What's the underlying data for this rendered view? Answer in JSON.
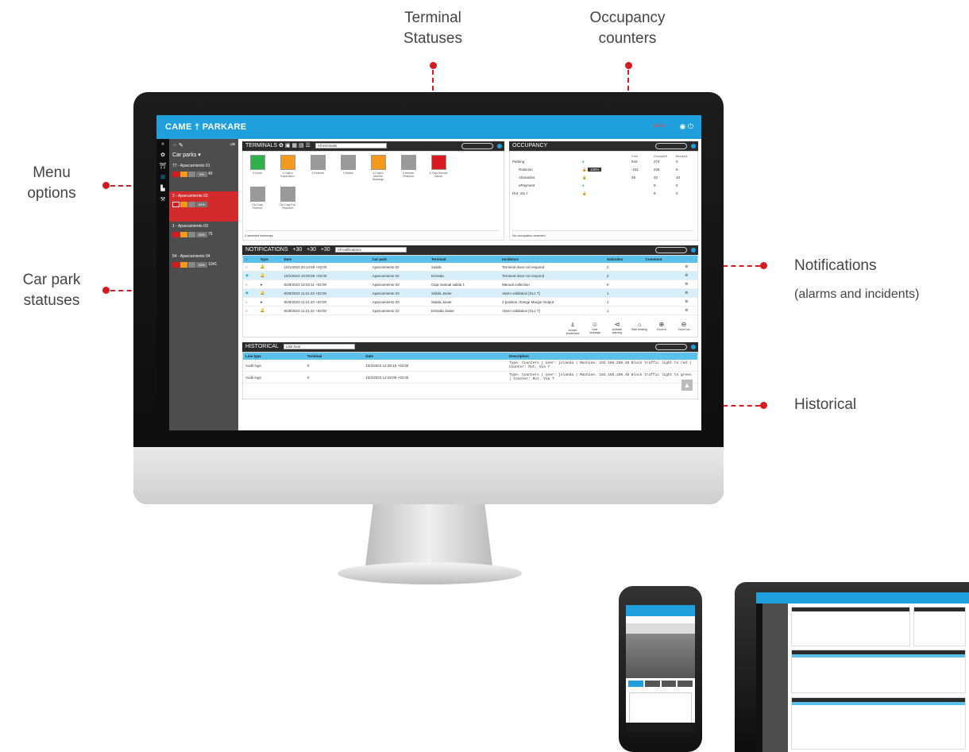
{
  "callouts": {
    "terminal_statuses": "Terminal\nStatuses",
    "occupancy_counters": "Occupancy\ncounters",
    "menu_options": "Menu\noptions",
    "car_park_statuses": "Car park\nstatuses",
    "notifications": "Notifications",
    "notifications_sub": "(alarms and incidents)",
    "historical": "Historical"
  },
  "app": {
    "brand": "CAME † PARKARE",
    "user": "admin"
  },
  "car_parks": {
    "header": "Car parks ▾",
    "items": [
      {
        "name": "77 - Aparcamiento 01",
        "pct": "9%",
        "n": "45"
      },
      {
        "name": "2 - Aparcamiento 02",
        "pct": "64%",
        "n": ""
      },
      {
        "name": "1 - Aparcamiento 03",
        "pct": "50%",
        "n": "75"
      },
      {
        "name": "54 - Aparcamiento 04",
        "pct": "50%",
        "n": "1041"
      }
    ]
  },
  "terminals": {
    "title": "TERMINALS",
    "filter": "All terminals",
    "footer": "2 selected terminals",
    "items": [
      {
        "label": "3-Inode",
        "color": "#2fb04a"
      },
      {
        "label": "1-Cajero Automatico",
        "color": "#f39a1e"
      },
      {
        "label": "2-Entrada",
        "color": "#8c8c8c"
      },
      {
        "label": "3-Salida",
        "color": "#8c8c8c"
      },
      {
        "label": "4-Cajero Manual Message",
        "color": "#f39a1e"
      },
      {
        "label": "5-Modulo Peatonal",
        "color": "#8c8c8c"
      },
      {
        "label": "6-Caja Manual Salida",
        "color": "#d71920"
      },
      {
        "label": "Ctrl-Caja Externa",
        "color": "#8c8c8c"
      },
      {
        "label": "Ctrl-Caja Ent. Payment",
        "color": "#8c8c8c"
      }
    ]
  },
  "occupancy": {
    "title": "OCCUPANCY",
    "footer": "No occupation selected",
    "columns": [
      "Free",
      "Occupied",
      "Blocked"
    ],
    "rows": [
      {
        "name": "Parking",
        "pct": "",
        "free": "543",
        "occ": "274",
        "blk": "0"
      },
      {
        "name": "Rotacion",
        "pct": "100%",
        "free": "-151",
        "occ": "226",
        "blk": "5"
      },
      {
        "name": "Abonados",
        "pct": "",
        "free": "48",
        "occ": "42",
        "blk": "10"
      },
      {
        "name": "ePayment",
        "pct": "",
        "free": "",
        "occ": "8",
        "blk": "0"
      },
      {
        "name": "Rot. Via 7",
        "pct": "",
        "free": "",
        "occ": "8",
        "blk": "0"
      }
    ]
  },
  "notifications": {
    "title": "NOTIFICATIONS",
    "counts": [
      "+30",
      "+30",
      "+30"
    ],
    "filter": "All notifications",
    "columns": [
      "Type",
      "Date",
      "Car park",
      "Terminal",
      "Incidence",
      "Subindex",
      "Comment"
    ],
    "rows": [
      {
        "date": "10/1/2023 20:14:59 +02:00",
        "park": "Aparcamiento 02",
        "term": "Salida",
        "inc": "Terminal does not respond",
        "sub": "2"
      },
      {
        "date": "10/1/2023 19:00:59 +02:00",
        "park": "Aparcamiento 02",
        "term": "Entrada",
        "inc": "Terminal does not respond",
        "sub": "2"
      },
      {
        "date": "9/29/2023 12:02:11 +02:00",
        "park": "Aparcamiento 03",
        "term": "Caja manual salida 1",
        "inc": "Manual collection",
        "sub": "0"
      },
      {
        "date": "9/29/2023 11:21:43 +02:00",
        "park": "Aparcamiento 03",
        "term": "Salida Javier",
        "inc": "Alarm validation [SL1 T]",
        "sub": "1"
      },
      {
        "date": "9/29/2023 11:21:43 +02:00",
        "park": "Aparcamiento 03",
        "term": "Salida Javier",
        "inc": "2 position change Margin Output",
        "sub": "1"
      },
      {
        "date": "9/29/2023 11:21:42 +02:00",
        "park": "Aparcamiento 03",
        "term": "Entrada Javier",
        "inc": "Alarm validation [SL1 T]",
        "sub": "1"
      }
    ],
    "actions": [
      "Accept incidences",
      "User message",
      "Activate warning",
      "Start blinking",
      "Zoom in",
      "Zoom out"
    ]
  },
  "historical": {
    "title": "HISTORICAL",
    "filter": "Last hour",
    "columns": [
      "Line type",
      "Terminal",
      "Date",
      "Description"
    ],
    "rows": [
      {
        "type": "Audit logs",
        "term": "0",
        "date": "10/2/2023 12:28:15 +02:00",
        "desc": "Type: Counters | User: jolanda | Machine: 192.168.289.48 Block traffic light to red | Counter: Rot. Via 7"
      },
      {
        "type": "Audit logs",
        "term": "0",
        "date": "10/2/2023 12:28:09 +02:00",
        "desc": "Type: Counters | User: jolanda | Machine: 192.168.289.48 Block traffic light to green | Counter: Rot. Via 7"
      }
    ]
  },
  "colors": {
    "accent": "#1fa0dd",
    "red": "#d71920",
    "orange": "#f39a1e",
    "green": "#2fb04a"
  }
}
